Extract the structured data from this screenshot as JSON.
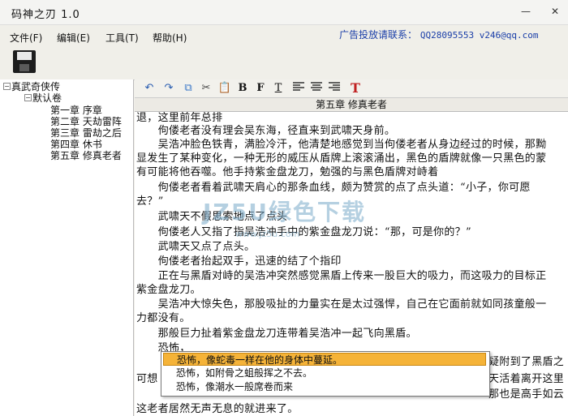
{
  "window": {
    "title": "码神之刃 1.0",
    "minimize_glyph": "—",
    "close_glyph": "✕"
  },
  "menu": [
    {
      "label": "文件(F)"
    },
    {
      "label": "编辑(E)"
    },
    {
      "label": "工具(T)"
    },
    {
      "label": "帮助(H)"
    }
  ],
  "ad": {
    "label": "广告投放请联系：",
    "contact": "QQ28095553 v246@qq.com"
  },
  "toolbar": {
    "save_icon": "floppy-disk-icon"
  },
  "tree": {
    "root": "真武奇侠传",
    "volume": "默认卷",
    "chapters": [
      "第一章 序章",
      "第二章 天劫雷阵",
      "第三章 雷劫之后",
      "第四章 休书",
      "第五章 修真老者"
    ]
  },
  "editor_toolbar": {
    "undo": "↶",
    "redo": "↷",
    "copy": "⧉",
    "cut": "✂",
    "paste": "📋",
    "bold": "B",
    "italic": "F",
    "text": "T",
    "font": "T"
  },
  "chapter_title": "第五章 修真老者",
  "lines": [
    "退，这里前年总排",
    "　　佝偻老者没有理会吴东海，径直来到武啸天身前。",
    "　　吴浩冲脸色铁青，满脸冷汗，他清楚地感觉到当佝偻老者从身边经过的时候，那黝",
    "显发生了某种变化，一种无形的威压从盾牌上滚滚涌出，黑色的盾牌就像一只黑色的蒙",
    "有可能将他吞噬。他手持紫金盘龙刀，勉强的与黑色盾牌对峙着",
    "　　佝偻老者看着武啸天肩心的那条血线，颇为赞赏的点了点头道：“小子，你可愿",
    "去？”",
    "　　武啸天不假思索地点了点头",
    "　　佝偻老人又指了指吴浩冲手中的紫金盘龙刀说：“那，可是你的？”",
    "　　武啸天又点了点头。",
    "　　佝偻老者抬起双手，迅速的结了个指印",
    "　　正在与黑盾对峙的吴浩冲突然感觉黑盾上传来一股巨大的吸力，而这吸力的目标正",
    "紫金盘龙刀。",
    "　　吴浩冲大惊失色，那股吸扯的力量实在是太过强悍，自己在它面前就如同孩童般一",
    "力都没有。",
    "　　那般巨力扯着紫金盘龙刀连带着吴浩冲一起飞向黑盾。",
    "　　恐怖，",
    "　　　　　　　　　　　　　　　　　　　　　　　　　　　　　　　　　　　　　　　　　　　　　　　　　　　　　　　　　　　　　　　　　　　　　　　　　　　　　　　　　　　　　　　　　　　　　　　　　　　　　",
    "可想",
    "这老者居然无声无息的就进来了。"
  ],
  "line_tails": {
    "l17": "疑附到了黑盾之",
    "l18": "天活着离开这里",
    "l19": "那也是高手如云"
  },
  "autocomplete": [
    "恐怖，像蛇毒一样在他的身体中蔓延。",
    "恐怖，如附骨之蛆般挥之不去。",
    "恐怖，像潮水一般席卷而来"
  ],
  "watermark": {
    "main": "JZ5U绿色下载",
    "sub": "www.jz5u.com"
  },
  "colors": {
    "accent": "#1a3ea8",
    "selection": "#f5b338"
  }
}
